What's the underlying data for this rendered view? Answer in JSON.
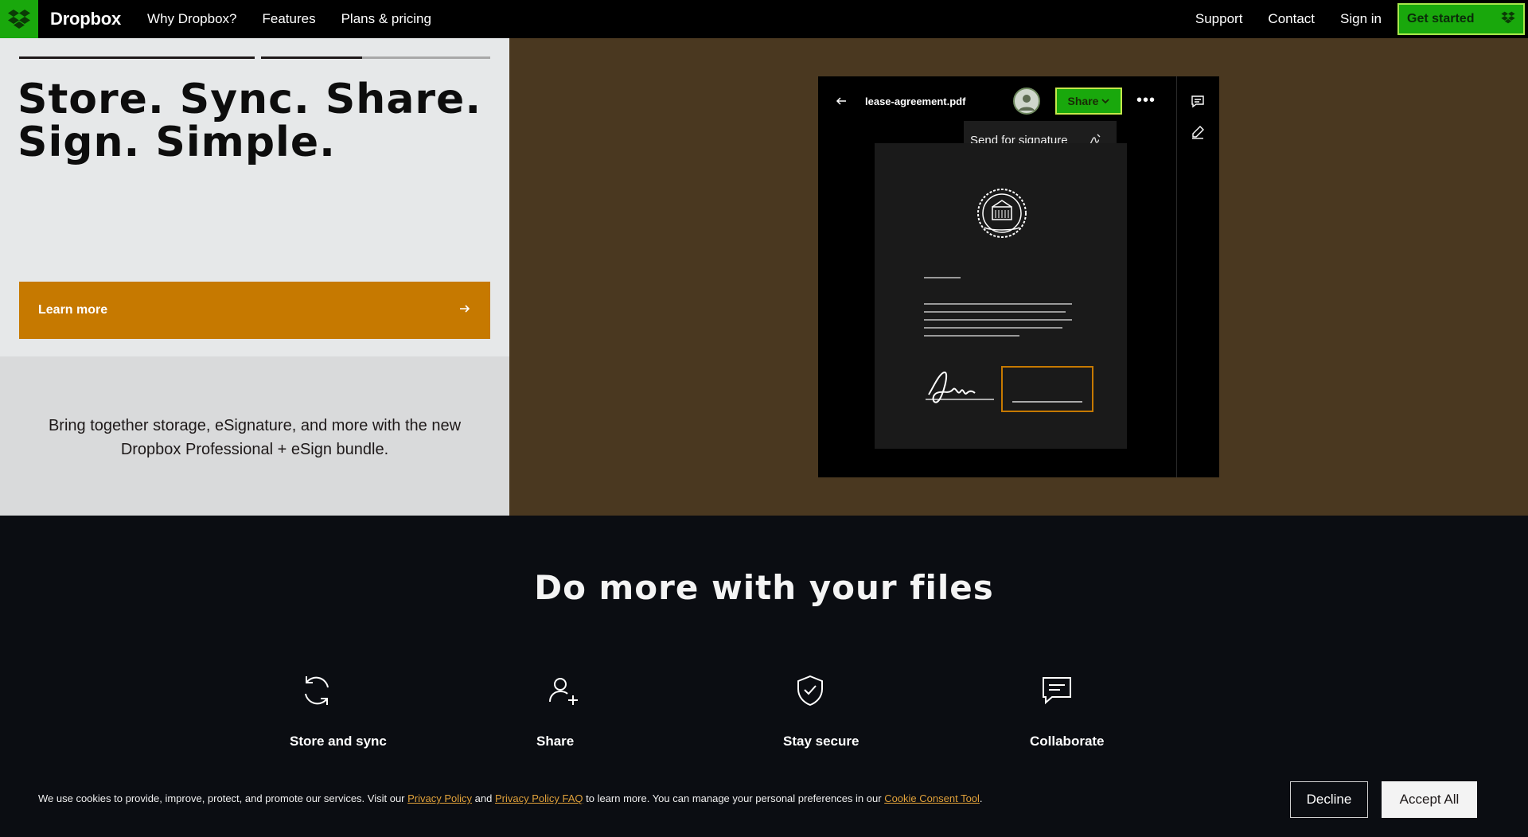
{
  "nav": {
    "brand": "Dropbox",
    "links": [
      "Why Dropbox?",
      "Features",
      "Plans & pricing"
    ],
    "right_links": [
      "Support",
      "Contact",
      "Sign in"
    ],
    "cta_label": "Get started"
  },
  "hero": {
    "headline_line1": "Store. Sync. Share.",
    "headline_line2": "Sign. Simple.",
    "learn_more": "Learn more",
    "subtext": "Bring together storage, eSignature, and more with the new Dropbox Professional + eSign bundle.",
    "carousel_progress": 0.63
  },
  "preview": {
    "file_name": "lease-agreement.pdf",
    "share_label": "Share",
    "dropdown_item": "Send for signature"
  },
  "features": {
    "title": "Do more with your files",
    "items": [
      {
        "label": "Store and sync",
        "icon": "sync-icon"
      },
      {
        "label": "Share",
        "icon": "add-user-icon"
      },
      {
        "label": "Stay secure",
        "icon": "shield-check-icon"
      },
      {
        "label": "Collaborate",
        "icon": "comment-icon"
      }
    ]
  },
  "cookie": {
    "text_1": "We use cookies to provide, improve, protect, and promote our services. Visit our ",
    "link_privacy": "Privacy Policy",
    "text_2": " and ",
    "link_faq": "Privacy Policy FAQ",
    "text_3": " to learn more. You can manage your personal preferences in our ",
    "link_tool": "Cookie Consent Tool",
    "text_4": ".",
    "decline": "Decline",
    "accept": "Accept All"
  },
  "colors": {
    "accent_orange": "#c67900",
    "brand_green": "#19a80c",
    "hero_brown": "#4a3820"
  }
}
